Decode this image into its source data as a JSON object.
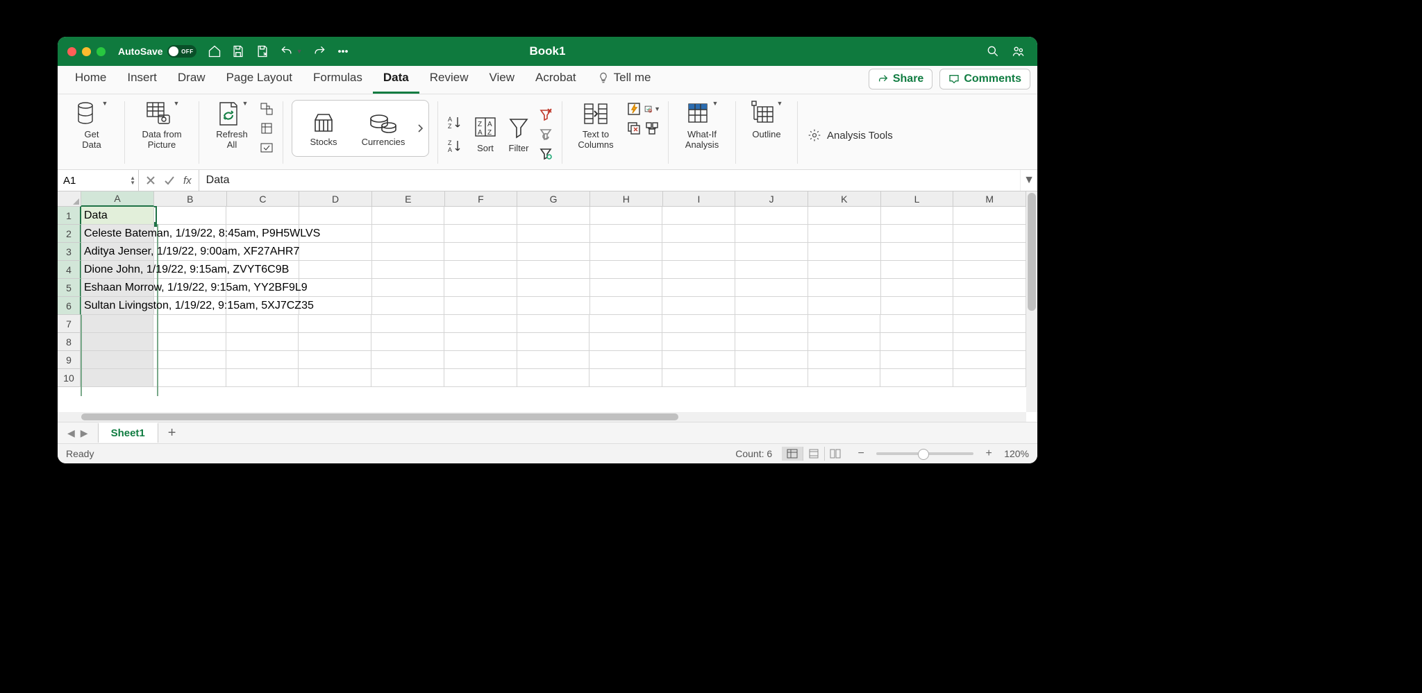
{
  "titlebar": {
    "autosave_label": "AutoSave",
    "autosave_state": "OFF",
    "workbook_title": "Book1"
  },
  "tabs": {
    "items": [
      "Home",
      "Insert",
      "Draw",
      "Page Layout",
      "Formulas",
      "Data",
      "Review",
      "View",
      "Acrobat"
    ],
    "active": "Data",
    "tellme": "Tell me",
    "share": "Share",
    "comments": "Comments"
  },
  "ribbon": {
    "get_data": "Get\nData",
    "data_from_picture": "Data from\nPicture",
    "refresh_all": "Refresh\nAll",
    "stocks": "Stocks",
    "currencies": "Currencies",
    "sort": "Sort",
    "filter": "Filter",
    "text_to_columns": "Text to\nColumns",
    "what_if": "What-If\nAnalysis",
    "outline": "Outline",
    "analysis_tools": "Analysis Tools"
  },
  "formula_bar": {
    "name_box": "A1",
    "formula": "Data"
  },
  "grid": {
    "columns": [
      "A",
      "B",
      "C",
      "D",
      "E",
      "F",
      "G",
      "H",
      "I",
      "J",
      "K",
      "L",
      "M"
    ],
    "selected_column": "A",
    "row_count": 10,
    "selected_rows_end": 6,
    "cells": {
      "A1": "Data",
      "A2": "Celeste Bateman, 1/19/22, 8:45am, P9H5WLVS",
      "A3": "Aditya Jenser, 1/19/22, 9:00am, XF27AHR7",
      "A4": "Dione John, 1/19/22, 9:15am, ZVYT6C9B",
      "A5": "Eshaan Morrow, 1/19/22, 9:15am, YY2BF9L9",
      "A6": "Sultan Livingston, 1/19/22, 9:15am, 5XJ7CZ35"
    }
  },
  "sheets": {
    "active": "Sheet1"
  },
  "status": {
    "mode": "Ready",
    "count_label": "Count: 6",
    "zoom": "120%"
  }
}
